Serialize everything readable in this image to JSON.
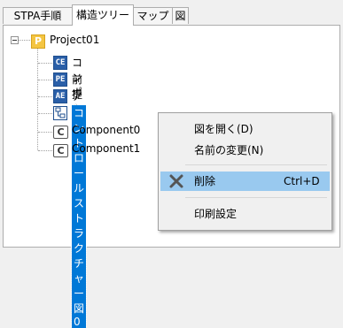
{
  "tabs": [
    {
      "label": "STPA手順"
    },
    {
      "label": "構造ツリー",
      "active": true
    },
    {
      "label": "マップ"
    },
    {
      "label": "図"
    }
  ],
  "tree": {
    "project": {
      "label": "Project01",
      "icon": "project-icon",
      "icon_text": "P"
    },
    "items": [
      {
        "label": "コンポーネント抽出表",
        "icon": "table-icon",
        "icon_text": "CE"
      },
      {
        "label": "前提条件表",
        "icon": "table-icon",
        "icon_text": "PE"
      },
      {
        "label": "アクシデントハザード安全制約表",
        "icon": "table-icon",
        "icon_text": "AE"
      },
      {
        "label": "コントロールストラクチャー図0",
        "icon": "diagram-icon",
        "selected": true
      },
      {
        "label": "Component0",
        "icon": "component-icon",
        "icon_text": "C"
      },
      {
        "label": "Component1",
        "icon": "component-icon",
        "icon_text": "C"
      }
    ]
  },
  "context_menu": {
    "open": "図を開く(D)",
    "rename": "名前の変更(N)",
    "delete": "削除",
    "delete_shortcut": "Ctrl+D",
    "print_settings": "印刷設定"
  },
  "colors": {
    "selection": "#0078d7",
    "menu_hover": "#99c9ef",
    "project_icon": "#f4c542",
    "table_icon": "#2a5fa8"
  }
}
